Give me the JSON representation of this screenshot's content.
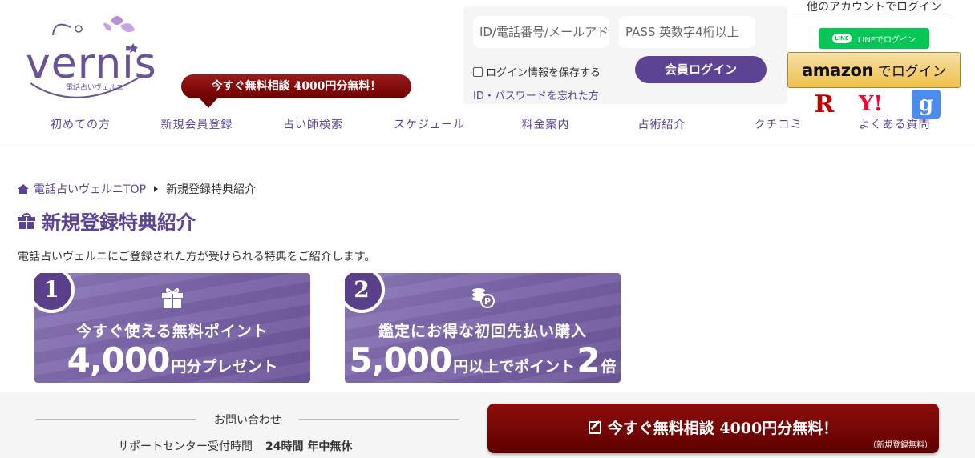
{
  "header": {
    "logo_text": "vernis",
    "logo_sub": "電話占いヴェルニ",
    "promo_label": "今すぐ無料相談 4000円分無料！"
  },
  "login": {
    "id_placeholder": "ID/電話番号/メールアドレス",
    "pass_placeholder": "PASS 英数字4桁以上",
    "save_label": "ログイン情報を保存する",
    "submit_label": "会員ログイン",
    "forgot_label": "ID・パスワードを忘れた方"
  },
  "social": {
    "title": "他のアカウントでログイン",
    "line_badge": "LINE",
    "line_label": "LINEでログイン",
    "amazon_word": "amazon",
    "amazon_label": "でログイン",
    "rakuten": "R",
    "yahoo": "Y!",
    "google": "g"
  },
  "nav": {
    "items": [
      "初めての方",
      "新規会員登録",
      "占い師検索",
      "スケジュール",
      "料金案内",
      "占術紹介",
      "クチコミ",
      "よくある質問"
    ]
  },
  "breadcrumb": {
    "home": "電話占いヴェルニTOP",
    "current": "新規登録特典紹介"
  },
  "page": {
    "title": "新規登録特典紹介",
    "intro": "電話占いヴェルニにご登録された方が受けられる特典をご紹介します。"
  },
  "benefits": [
    {
      "number": "1",
      "line1": "今すぐ使える無料ポイント",
      "big": "4,000",
      "tail": "円分プレゼント",
      "icon": "gift-icon"
    },
    {
      "number": "2",
      "line1": "鑑定にお得な初回先払い購入",
      "big": "5,000",
      "tail": "円以上でポイント",
      "big2": "2",
      "tail2": "倍",
      "icon": "coin-icon"
    }
  ],
  "footer": {
    "contact_title": "お問い合わせ",
    "support_label": "サポートセンター受付時間",
    "support_hours": "24時間 年中無休",
    "promo_label": "今すぐ無料相談 4000円分無料！",
    "promo_note": "（新規登録無料）"
  },
  "colors": {
    "brand_purple": "#5d4394",
    "promo_red": "#7a0000",
    "line_green": "#06c755",
    "amazon_gold": "#f0c14b"
  }
}
